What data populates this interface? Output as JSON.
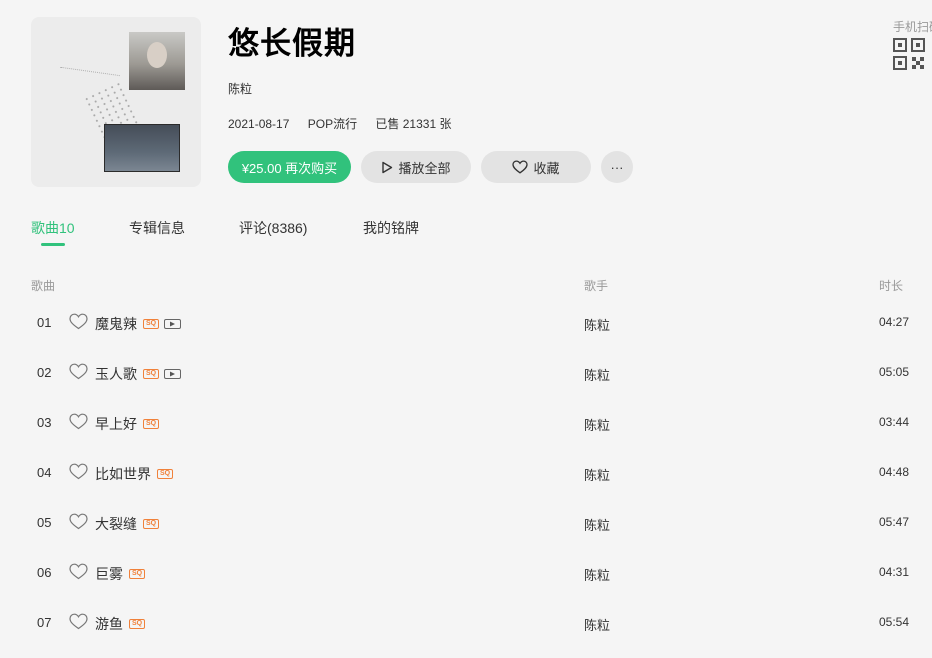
{
  "album": {
    "title": "悠长假期",
    "artist": "陈粒",
    "release_date": "2021-08-17",
    "genre": "POP流行",
    "sales": "已售 21331 张"
  },
  "actions": {
    "buy_label": "¥25.00 再次购买",
    "play_label": "播放全部",
    "fav_label": "收藏",
    "more_label": "···"
  },
  "qr": {
    "label": "手机扫码"
  },
  "tabs": [
    {
      "label": "歌曲10",
      "active": true
    },
    {
      "label": "专辑信息"
    },
    {
      "label": "评论(8386)"
    },
    {
      "label": "我的铭牌"
    }
  ],
  "columns": {
    "song": "歌曲",
    "singer": "歌手",
    "duration": "时长"
  },
  "songs": [
    {
      "num": "01",
      "name": "魔鬼辣",
      "quality": "SQ",
      "mv": true,
      "singer": "陈粒",
      "duration": "04:27"
    },
    {
      "num": "02",
      "name": "玉人歌",
      "quality": "SQ",
      "mv": true,
      "singer": "陈粒",
      "duration": "05:05"
    },
    {
      "num": "03",
      "name": "早上好",
      "quality": "SQ",
      "mv": false,
      "singer": "陈粒",
      "duration": "03:44"
    },
    {
      "num": "04",
      "name": "比如世界",
      "quality": "SQ",
      "mv": false,
      "singer": "陈粒",
      "duration": "04:48"
    },
    {
      "num": "05",
      "name": "大裂缝",
      "quality": "SQ",
      "mv": false,
      "singer": "陈粒",
      "duration": "05:47"
    },
    {
      "num": "06",
      "name": "巨雾",
      "quality": "SQ",
      "mv": false,
      "singer": "陈粒",
      "duration": "04:31"
    },
    {
      "num": "07",
      "name": "游鱼",
      "quality": "SQ",
      "mv": false,
      "singer": "陈粒",
      "duration": "05:54"
    }
  ],
  "colors": {
    "accent": "#31c27c",
    "badge": "#f0813a",
    "muted": "#999999"
  }
}
